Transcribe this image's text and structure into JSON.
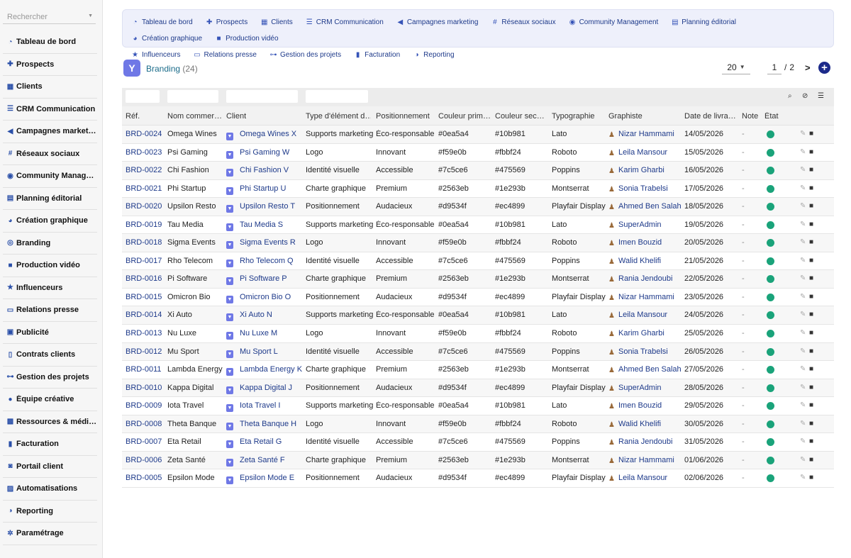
{
  "sidebar": {
    "search_placeholder": "Rechercher",
    "items": [
      {
        "label": "Tableau de bord",
        "icon": "dashboard-icon",
        "glyph": "◔"
      },
      {
        "label": "Prospects",
        "icon": "user-plus-icon",
        "glyph": "✚"
      },
      {
        "label": "Clients",
        "icon": "building-icon",
        "glyph": "▦"
      },
      {
        "label": "CRM Communication",
        "icon": "list-icon",
        "glyph": "☰"
      },
      {
        "label": "Campagnes marketing",
        "icon": "megaphone-icon",
        "glyph": "◀"
      },
      {
        "label": "Réseaux sociaux",
        "icon": "hashtag-icon",
        "glyph": "#"
      },
      {
        "label": "Community Management",
        "icon": "comments-icon",
        "glyph": "◉"
      },
      {
        "label": "Planning éditorial",
        "icon": "calendar-icon",
        "glyph": "▤"
      },
      {
        "label": "Création graphique",
        "icon": "palette-icon",
        "glyph": "◕"
      },
      {
        "label": "Branding",
        "icon": "fingerprint-icon",
        "glyph": "◎"
      },
      {
        "label": "Production vidéo",
        "icon": "video-icon",
        "glyph": "■"
      },
      {
        "label": "Influenceurs",
        "icon": "star-icon",
        "glyph": "★"
      },
      {
        "label": "Relations presse",
        "icon": "newspaper-icon",
        "glyph": "▭"
      },
      {
        "label": "Publicité",
        "icon": "ad-icon",
        "glyph": "▣"
      },
      {
        "label": "Contrats clients",
        "icon": "contract-icon",
        "glyph": "▯"
      },
      {
        "label": "Gestion des projets",
        "icon": "project-diagram-icon",
        "glyph": "⊶"
      },
      {
        "label": "Équipe créative",
        "icon": "users-icon",
        "glyph": "●"
      },
      {
        "label": "Ressources & médias",
        "icon": "photo-video-icon",
        "glyph": "▩"
      },
      {
        "label": "Facturation",
        "icon": "invoice-icon",
        "glyph": "▮"
      },
      {
        "label": "Portail client",
        "icon": "user-portal-icon",
        "glyph": "◙"
      },
      {
        "label": "Automatisations",
        "icon": "robot-icon",
        "glyph": "▨"
      },
      {
        "label": "Reporting",
        "icon": "chart-pie-icon",
        "glyph": "◑"
      },
      {
        "label": "Paramétrage",
        "icon": "gear-icon",
        "glyph": "✲"
      }
    ]
  },
  "topnav": {
    "row1": [
      {
        "label": "Tableau de bord",
        "icon": "dashboard-icon",
        "glyph": "◔"
      },
      {
        "label": "Prospects",
        "icon": "user-plus-icon",
        "glyph": "✚"
      },
      {
        "label": "Clients",
        "icon": "building-icon",
        "glyph": "▦"
      },
      {
        "label": "CRM Communication",
        "icon": "list-icon",
        "glyph": "☰"
      },
      {
        "label": "Campagnes marketing",
        "icon": "megaphone-icon",
        "glyph": "◀"
      },
      {
        "label": "Réseaux sociaux",
        "icon": "hashtag-icon",
        "glyph": "#"
      },
      {
        "label": "Community Management",
        "icon": "comments-icon",
        "glyph": "◉"
      },
      {
        "label": "Planning éditorial",
        "icon": "calendar-icon",
        "glyph": "▤"
      },
      {
        "label": "Création graphique",
        "icon": "palette-icon",
        "glyph": "◕"
      },
      {
        "label": "Production vidéo",
        "icon": "video-icon",
        "glyph": "■"
      }
    ],
    "row2": [
      {
        "label": "Influenceurs",
        "icon": "star-icon",
        "glyph": "★"
      },
      {
        "label": "Relations presse",
        "icon": "newspaper-icon",
        "glyph": "▭"
      },
      {
        "label": "Gestion des projets",
        "icon": "project-diagram-icon",
        "glyph": "⊶"
      },
      {
        "label": "Facturation",
        "icon": "invoice-icon",
        "glyph": "▮"
      },
      {
        "label": "Reporting",
        "icon": "chart-pie-icon",
        "glyph": "◑"
      }
    ]
  },
  "page": {
    "title": "Branding",
    "count": "(24)",
    "icon": "filter-funnel-icon",
    "icon_glyph": "Y"
  },
  "pager": {
    "per_page": "20",
    "current": "1",
    "separator": "/",
    "total": "2",
    "next_glyph": ">",
    "add_glyph": "+"
  },
  "table": {
    "headers": {
      "ref": "Réf.",
      "nom": "Nom commer…",
      "client": "Client",
      "type": "Type d'élément d…",
      "pos": "Positionnement",
      "c1": "Couleur prim…",
      "c2": "Couleur sec…",
      "typo": "Typographie",
      "graph": "Graphiste",
      "date": "Date de livra…",
      "note": "Note",
      "etat": "État"
    },
    "status_color": "#1aa37a",
    "rows": [
      {
        "ref": "BRD-0024",
        "nom": "Omega Wines",
        "client": "Omega Wines X",
        "type": "Supports marketing",
        "pos": "Éco-responsable",
        "c1": "#0ea5a4",
        "c2": "#10b981",
        "typo": "Lato",
        "graph": "Nizar Hammami",
        "date": "14/05/2026",
        "note": "-"
      },
      {
        "ref": "BRD-0023",
        "nom": "Psi Gaming",
        "client": "Psi Gaming W",
        "type": "Logo",
        "pos": "Innovant",
        "c1": "#f59e0b",
        "c2": "#fbbf24",
        "typo": "Roboto",
        "graph": "Leila Mansour",
        "date": "15/05/2026",
        "note": "-"
      },
      {
        "ref": "BRD-0022",
        "nom": "Chi Fashion",
        "client": "Chi Fashion V",
        "type": "Identité visuelle",
        "pos": "Accessible",
        "c1": "#7c5ce6",
        "c2": "#475569",
        "typo": "Poppins",
        "graph": "Karim Gharbi",
        "date": "16/05/2026",
        "note": "-"
      },
      {
        "ref": "BRD-0021",
        "nom": "Phi Startup",
        "client": "Phi Startup U",
        "type": "Charte graphique",
        "pos": "Premium",
        "c1": "#2563eb",
        "c2": "#1e293b",
        "typo": "Montserrat",
        "graph": "Sonia Trabelsi",
        "date": "17/05/2026",
        "note": "-"
      },
      {
        "ref": "BRD-0020",
        "nom": "Upsilon Resto",
        "client": "Upsilon Resto T",
        "type": "Positionnement",
        "pos": "Audacieux",
        "c1": "#d9534f",
        "c2": "#ec4899",
        "typo": "Playfair Display",
        "graph": "Ahmed Ben Salah",
        "date": "18/05/2026",
        "note": "-"
      },
      {
        "ref": "BRD-0019",
        "nom": "Tau Media",
        "client": "Tau Media S",
        "type": "Supports marketing",
        "pos": "Éco-responsable",
        "c1": "#0ea5a4",
        "c2": "#10b981",
        "typo": "Lato",
        "graph": "SuperAdmin",
        "date": "19/05/2026",
        "note": "-"
      },
      {
        "ref": "BRD-0018",
        "nom": "Sigma Events",
        "client": "Sigma Events R",
        "type": "Logo",
        "pos": "Innovant",
        "c1": "#f59e0b",
        "c2": "#fbbf24",
        "typo": "Roboto",
        "graph": "Imen Bouzid",
        "date": "20/05/2026",
        "note": "-"
      },
      {
        "ref": "BRD-0017",
        "nom": "Rho Telecom",
        "client": "Rho Telecom Q",
        "type": "Identité visuelle",
        "pos": "Accessible",
        "c1": "#7c5ce6",
        "c2": "#475569",
        "typo": "Poppins",
        "graph": "Walid Khelifi",
        "date": "21/05/2026",
        "note": "-"
      },
      {
        "ref": "BRD-0016",
        "nom": "Pi Software",
        "client": "Pi Software P",
        "type": "Charte graphique",
        "pos": "Premium",
        "c1": "#2563eb",
        "c2": "#1e293b",
        "typo": "Montserrat",
        "graph": "Rania Jendoubi",
        "date": "22/05/2026",
        "note": "-"
      },
      {
        "ref": "BRD-0015",
        "nom": "Omicron Bio",
        "client": "Omicron Bio O",
        "type": "Positionnement",
        "pos": "Audacieux",
        "c1": "#d9534f",
        "c2": "#ec4899",
        "typo": "Playfair Display",
        "graph": "Nizar Hammami",
        "date": "23/05/2026",
        "note": "-"
      },
      {
        "ref": "BRD-0014",
        "nom": "Xi Auto",
        "client": "Xi Auto N",
        "type": "Supports marketing",
        "pos": "Éco-responsable",
        "c1": "#0ea5a4",
        "c2": "#10b981",
        "typo": "Lato",
        "graph": "Leila Mansour",
        "date": "24/05/2026",
        "note": "-"
      },
      {
        "ref": "BRD-0013",
        "nom": "Nu Luxe",
        "client": "Nu Luxe M",
        "type": "Logo",
        "pos": "Innovant",
        "c1": "#f59e0b",
        "c2": "#fbbf24",
        "typo": "Roboto",
        "graph": "Karim Gharbi",
        "date": "25/05/2026",
        "note": "-"
      },
      {
        "ref": "BRD-0012",
        "nom": "Mu Sport",
        "client": "Mu Sport L",
        "type": "Identité visuelle",
        "pos": "Accessible",
        "c1": "#7c5ce6",
        "c2": "#475569",
        "typo": "Poppins",
        "graph": "Sonia Trabelsi",
        "date": "26/05/2026",
        "note": "-"
      },
      {
        "ref": "BRD-0011",
        "nom": "Lambda Energy",
        "client": "Lambda Energy K",
        "type": "Charte graphique",
        "pos": "Premium",
        "c1": "#2563eb",
        "c2": "#1e293b",
        "typo": "Montserrat",
        "graph": "Ahmed Ben Salah",
        "date": "27/05/2026",
        "note": "-"
      },
      {
        "ref": "BRD-0010",
        "nom": "Kappa Digital",
        "client": "Kappa Digital J",
        "type": "Positionnement",
        "pos": "Audacieux",
        "c1": "#d9534f",
        "c2": "#ec4899",
        "typo": "Playfair Display",
        "graph": "SuperAdmin",
        "date": "28/05/2026",
        "note": "-"
      },
      {
        "ref": "BRD-0009",
        "nom": "Iota Travel",
        "client": "Iota Travel I",
        "type": "Supports marketing",
        "pos": "Éco-responsable",
        "c1": "#0ea5a4",
        "c2": "#10b981",
        "typo": "Lato",
        "graph": "Imen Bouzid",
        "date": "29/05/2026",
        "note": "-"
      },
      {
        "ref": "BRD-0008",
        "nom": "Theta Banque",
        "client": "Theta Banque H",
        "type": "Logo",
        "pos": "Innovant",
        "c1": "#f59e0b",
        "c2": "#fbbf24",
        "typo": "Roboto",
        "graph": "Walid Khelifi",
        "date": "30/05/2026",
        "note": "-"
      },
      {
        "ref": "BRD-0007",
        "nom": "Eta Retail",
        "client": "Eta Retail G",
        "type": "Identité visuelle",
        "pos": "Accessible",
        "c1": "#7c5ce6",
        "c2": "#475569",
        "typo": "Poppins",
        "graph": "Rania Jendoubi",
        "date": "31/05/2026",
        "note": "-"
      },
      {
        "ref": "BRD-0006",
        "nom": "Zeta Santé",
        "client": "Zeta Santé F",
        "type": "Charte graphique",
        "pos": "Premium",
        "c1": "#2563eb",
        "c2": "#1e293b",
        "typo": "Montserrat",
        "graph": "Nizar Hammami",
        "date": "01/06/2026",
        "note": "-"
      },
      {
        "ref": "BRD-0005",
        "nom": "Epsilon Mode",
        "client": "Epsilon Mode E",
        "type": "Positionnement",
        "pos": "Audacieux",
        "c1": "#d9534f",
        "c2": "#ec4899",
        "typo": "Playfair Display",
        "graph": "Leila Mansour",
        "date": "02/06/2026",
        "note": "-"
      }
    ]
  }
}
